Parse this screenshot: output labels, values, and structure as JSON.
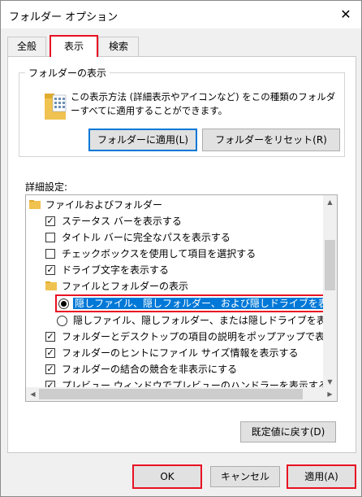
{
  "window": {
    "title": "フォルダー オプション",
    "close_glyph": "✕"
  },
  "tabs": [
    {
      "label": "全般"
    },
    {
      "label": "表示"
    },
    {
      "label": "検索"
    }
  ],
  "folder_views": {
    "title": "フォルダーの表示",
    "description": "この表示方法 (詳細表示やアイコンなど) をこの種類のフォルダーすべてに適用することができます。",
    "apply_button": "フォルダーに適用(L)",
    "reset_button": "フォルダーをリセット(R)"
  },
  "advanced": {
    "label": "詳細設定:",
    "items": [
      {
        "text": "ファイルおよびフォルダー",
        "type": "folder"
      },
      {
        "text": "ステータス バーを表示する",
        "type": "checkbox",
        "checked": true
      },
      {
        "text": "タイトル バーに完全なパスを表示する",
        "type": "checkbox",
        "checked": false
      },
      {
        "text": "チェックボックスを使用して項目を選択する",
        "type": "checkbox",
        "checked": false
      },
      {
        "text": "ドライブ文字を表示する",
        "type": "checkbox",
        "checked": true
      },
      {
        "text": "ファイルとフォルダーの表示",
        "type": "folder"
      },
      {
        "text": "隠しファイル、隠しフォルダー、および隠しドライブを表示する",
        "type": "radio",
        "checked": true,
        "selected": true
      },
      {
        "text": "隠しファイル、隠しフォルダー、または隠しドライブを表示しない",
        "type": "radio",
        "checked": false
      },
      {
        "text": "フォルダーとデスクトップの項目の説明をポップアップで表示する",
        "type": "checkbox",
        "checked": true
      },
      {
        "text": "フォルダーのヒントにファイル サイズ情報を表示する",
        "type": "checkbox",
        "checked": true
      },
      {
        "text": "フォルダーの結合の競合を非表示にする",
        "type": "checkbox",
        "checked": true
      },
      {
        "text": "プレビュー ウィンドウでプレビューのハンドラーを表示する",
        "type": "checkbox",
        "checked": true
      }
    ],
    "restore_button": "既定値に戻す(D)"
  },
  "footer": {
    "ok": "OK",
    "cancel": "キャンセル",
    "apply": "適用(A)"
  },
  "colors": {
    "accent": "#0078d7",
    "highlight_red": "#e81123"
  },
  "icons": {
    "check": "✓"
  }
}
